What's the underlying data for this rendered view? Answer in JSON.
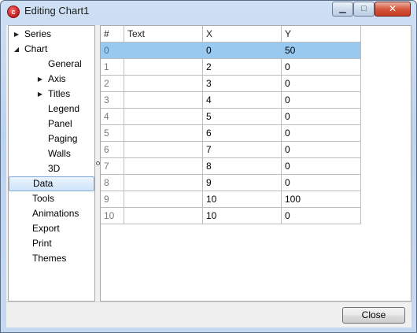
{
  "window": {
    "title": "Editing Chart1",
    "app_icon_glyph": "c",
    "minimize_glyph": "▁",
    "maximize_glyph": "□",
    "close_glyph": "✕"
  },
  "tree": {
    "items": [
      {
        "label": "Series",
        "arrow": "▶",
        "indent": 0
      },
      {
        "label": "Chart",
        "arrow": "◢",
        "indent": 0
      },
      {
        "label": "General",
        "arrow": "",
        "indent": 2
      },
      {
        "label": "Axis",
        "arrow": "▶",
        "indent": 2
      },
      {
        "label": "Titles",
        "arrow": "▶",
        "indent": 2
      },
      {
        "label": "Legend",
        "arrow": "",
        "indent": 2
      },
      {
        "label": "Panel",
        "arrow": "",
        "indent": 2
      },
      {
        "label": "Paging",
        "arrow": "",
        "indent": 2
      },
      {
        "label": "Walls",
        "arrow": "",
        "indent": 2
      },
      {
        "label": "3D",
        "arrow": "",
        "indent": 2
      },
      {
        "label": "Data",
        "arrow": "",
        "indent": 1,
        "selected": true
      },
      {
        "label": "Tools",
        "arrow": "",
        "indent": 1
      },
      {
        "label": "Animations",
        "arrow": "",
        "indent": 1
      },
      {
        "label": "Export",
        "arrow": "",
        "indent": 1
      },
      {
        "label": "Print",
        "arrow": "",
        "indent": 1
      },
      {
        "label": "Themes",
        "arrow": "",
        "indent": 1
      }
    ]
  },
  "grid": {
    "columns": [
      "#",
      "Text",
      "X",
      "Y"
    ],
    "rows": [
      [
        "0",
        "",
        "0",
        "50"
      ],
      [
        "1",
        "",
        "2",
        "0"
      ],
      [
        "2",
        "",
        "3",
        "0"
      ],
      [
        "3",
        "",
        "4",
        "0"
      ],
      [
        "4",
        "",
        "5",
        "0"
      ],
      [
        "5",
        "",
        "6",
        "0"
      ],
      [
        "6",
        "",
        "7",
        "0"
      ],
      [
        "7",
        "",
        "8",
        "0"
      ],
      [
        "8",
        "",
        "9",
        "0"
      ],
      [
        "9",
        "",
        "10",
        "100"
      ],
      [
        "10",
        "",
        "10",
        "0"
      ]
    ],
    "selected_row": 0
  },
  "footer": {
    "close_label": "Close"
  },
  "colors": {
    "selection": "#99c9ef",
    "tree_selection": "#cfe4fa",
    "close_button": "#c43b22"
  }
}
